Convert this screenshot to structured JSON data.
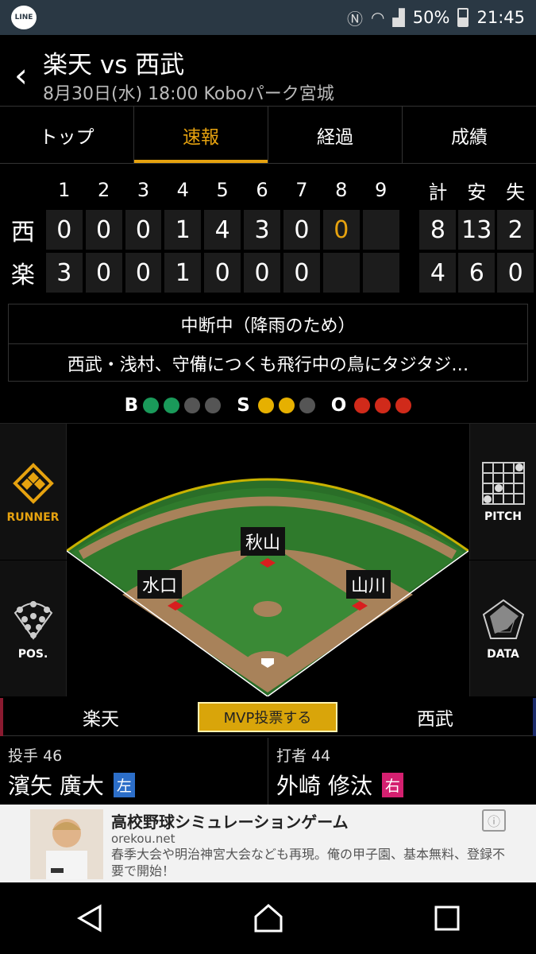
{
  "status_bar": {
    "battery": "50%",
    "time": "21:45",
    "line_label": "LINE"
  },
  "header": {
    "title": "楽天 vs 西武",
    "subtitle": "8月30日(水) 18:00 Koboパーク宮城"
  },
  "tabs": [
    {
      "label": "トップ",
      "active": false
    },
    {
      "label": "速報",
      "active": true
    },
    {
      "label": "経過",
      "active": false
    },
    {
      "label": "成績",
      "active": false
    }
  ],
  "scoreboard": {
    "innings": [
      "1",
      "2",
      "3",
      "4",
      "5",
      "6",
      "7",
      "8",
      "9"
    ],
    "totals_headers": [
      "計",
      "安",
      "失"
    ],
    "rows": [
      {
        "team": "西",
        "scores": [
          "0",
          "0",
          "0",
          "1",
          "4",
          "3",
          "0",
          "0",
          ""
        ],
        "totals": [
          "8",
          "13",
          "2"
        ]
      },
      {
        "team": "楽",
        "scores": [
          "3",
          "0",
          "0",
          "1",
          "0",
          "0",
          "0",
          "",
          ""
        ],
        "totals": [
          "4",
          "6",
          "0"
        ]
      }
    ]
  },
  "news": {
    "status": "中断中（降雨のため）",
    "headline": "西武・浅村、守備につくも飛行中の鳥にタジタジ…"
  },
  "count": {
    "b_label": "B",
    "s_label": "S",
    "o_label": "O",
    "balls": 2,
    "strikes": 2,
    "outs": 3
  },
  "side_buttons": {
    "runner": "RUNNER",
    "pitch": "PITCH",
    "pos": "POS.",
    "data": "DATA"
  },
  "field_players": {
    "center": "秋山",
    "left": "水口",
    "right": "山川"
  },
  "teams_bar": {
    "home": "楽天",
    "away": "西武",
    "mvp_label": "MVP投票する"
  },
  "pitcher": {
    "role": "投手",
    "number": "46",
    "name": "濱矢 廣大",
    "hand": "左"
  },
  "batter": {
    "role": "打者",
    "number": "44",
    "name": "外崎 修汰",
    "hand": "右"
  },
  "ad": {
    "title": "高校野球シミュレーションゲーム",
    "url": "orekou.net",
    "description": "春季大会や明治神宮大会なども再現。俺の甲子園、基本無料、登録不要で開始！"
  }
}
